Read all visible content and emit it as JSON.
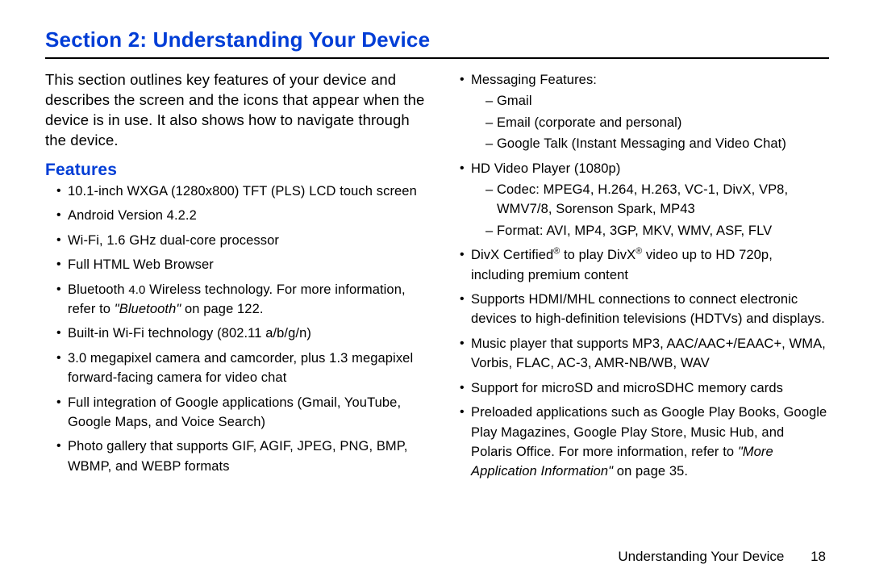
{
  "title": "Section 2: Understanding Your Device",
  "intro": "This section outlines key features of your device and describes the screen and the icons that appear when the device is in use. It also shows how to navigate through the device.",
  "features_heading": "Features",
  "left": [
    {
      "text": "10.1-inch WXGA (1280x800) TFT (PLS) LCD touch screen"
    },
    {
      "text": "Android Version 4.2.2"
    },
    {
      "text": "Wi-Fi, 1.6 GHz dual-core processor"
    },
    {
      "text": "Full HTML Web Browser"
    },
    {
      "pre": "Bluetooth ",
      "small": "4.0",
      "mid": " Wireless technology. For more information, refer to ",
      "xref": "\"Bluetooth\"",
      "post": " on page 122."
    },
    {
      "text": "Built-in Wi-Fi technology (802.11 a/b/g/n)"
    },
    {
      "text": "3.0 megapixel camera and camcorder, plus 1.3 megapixel forward-facing camera for video chat"
    },
    {
      "text": "Full integration of Google applications (Gmail, YouTube, Google Maps, and Voice Search)"
    },
    {
      "text": "Photo gallery that supports GIF, AGIF, JPEG, PNG, BMP, WBMP, and WEBP formats"
    }
  ],
  "right": [
    {
      "text": "Messaging Features:",
      "sub": [
        "Gmail",
        "Email (corporate and personal)",
        "Google Talk (Instant Messaging and Video Chat)"
      ]
    },
    {
      "text": "HD Video Player (1080p)",
      "sub": [
        "Codec: MPEG4, H.264, H.263, VC-1, DivX, VP8, WMV7/8, Sorenson Spark, MP43",
        "Format: AVI, MP4, 3GP, MKV, WMV, ASF, FLV"
      ]
    },
    {
      "divx_a": "DivX Certified",
      "divx_b": " to play DivX",
      "divx_c": " video up to HD 720p, including premium content"
    },
    {
      "text": "Supports HDMI/MHL connections to connect electronic devices to high-definition televisions (HDTVs) and displays."
    },
    {
      "text": "Music player that supports MP3, AAC/AAC+/EAAC+, WMA, Vorbis, FLAC, AC-3, AMR-NB/WB, WAV"
    },
    {
      "text": "Support for microSD and microSDHC memory cards"
    },
    {
      "pre": "Preloaded applications such as Google Play Books, Google Play Magazines, Google Play Store, Music Hub, and Polaris Office. For more information, refer to ",
      "xref": "\"More Application Information\"",
      "post": " on page 35."
    }
  ],
  "footer_label": "Understanding Your Device",
  "footer_page": "18",
  "reg": "®"
}
